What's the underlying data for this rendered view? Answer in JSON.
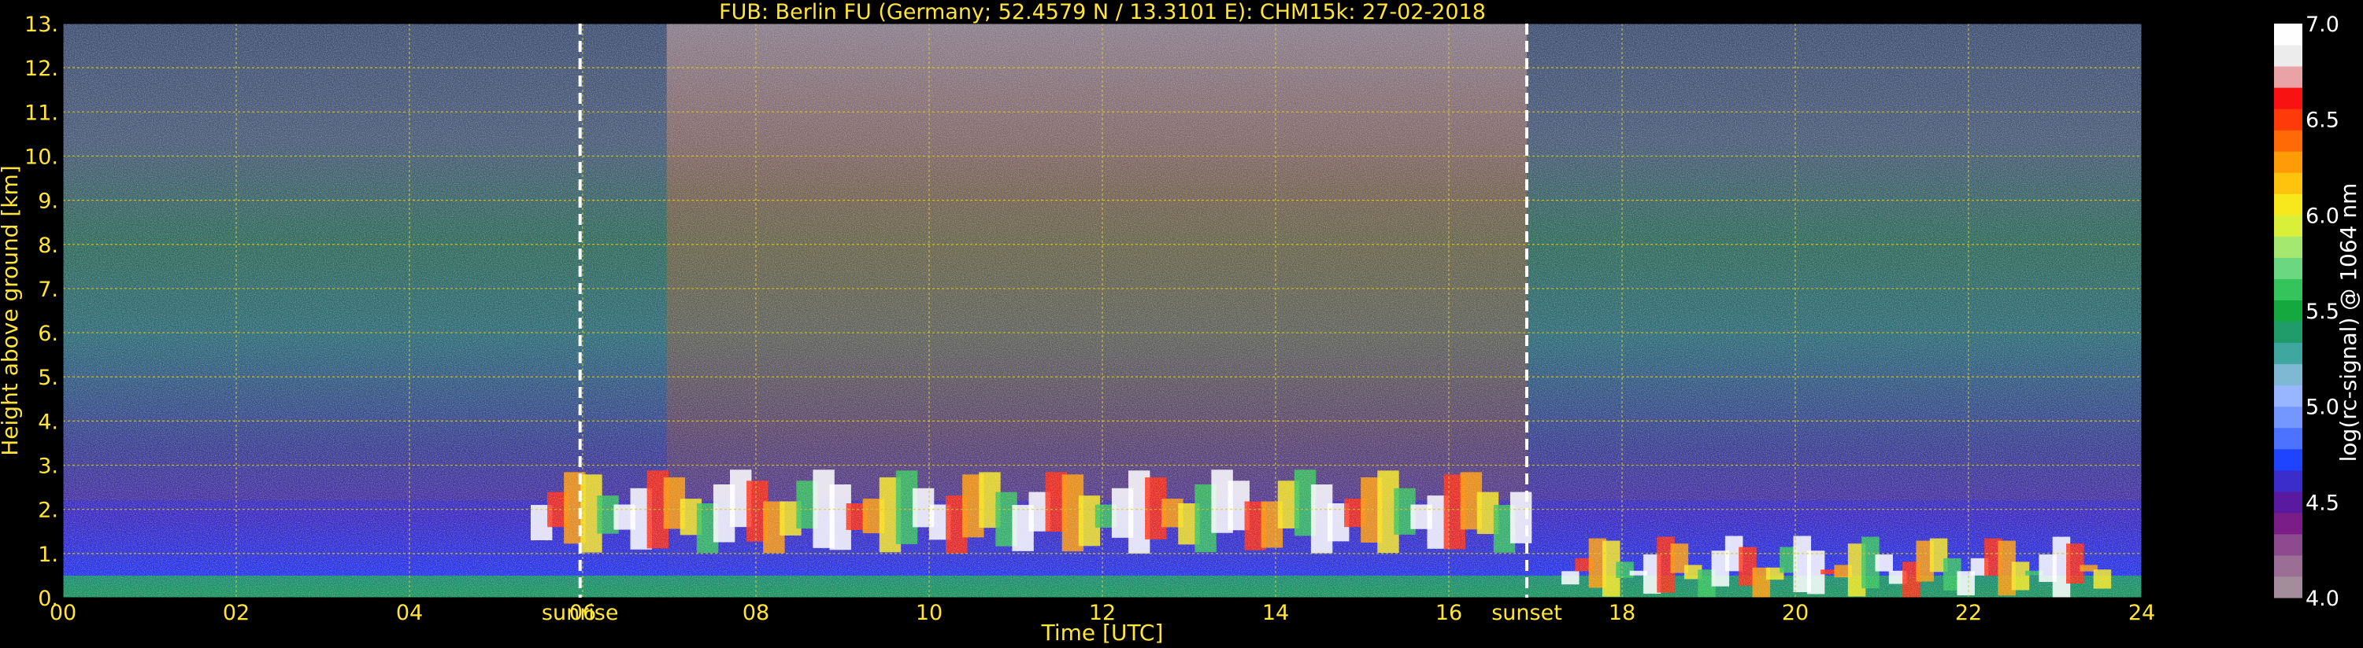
{
  "chart_data": {
    "type": "heatmap",
    "title": "FUB: Berlin FU (Germany; 52.4579 N / 13.3101 E):    CHM15k: 27-02-2018",
    "xlabel": "Time [UTC]",
    "ylabel": "Height above ground [km]",
    "xlim": [
      0,
      24
    ],
    "ylim": [
      0,
      13
    ],
    "x_ticks": [
      "00",
      "02",
      "04",
      "06",
      "08",
      "10",
      "12",
      "14",
      "16",
      "18",
      "20",
      "22",
      "24"
    ],
    "y_ticks": [
      "0.",
      "1.",
      "2.",
      "3.",
      "4.",
      "5.",
      "6.",
      "7.",
      "8.",
      "9.",
      "10.",
      "11.",
      "12.",
      "13."
    ],
    "grid": true,
    "markers": [
      {
        "label": "sunrise",
        "x": 5.97
      },
      {
        "label": "sunset",
        "x": 16.9
      }
    ],
    "colorbar": {
      "label": "log(rc-signal) @ 1064 nm",
      "range": [
        4.0,
        7.0
      ],
      "ticks": [
        "4.0",
        "4.5",
        "5.0",
        "5.5",
        "6.0",
        "6.5",
        "7.0"
      ],
      "colors": [
        "#a38d9b",
        "#9b6f95",
        "#8d4a8e",
        "#7a1d86",
        "#5a1aa0",
        "#3b2ccc",
        "#1f44ff",
        "#4b73ff",
        "#7397ff",
        "#98b6ff",
        "#7fb8d3",
        "#3fa6a0",
        "#1f9c6a",
        "#14a83f",
        "#35c35c",
        "#6bd780",
        "#a5e870",
        "#d8f03a",
        "#f7e81d",
        "#ffc20d",
        "#ff9b06",
        "#ff6a06",
        "#ff3a0a",
        "#f81212",
        "#e9a2a6",
        "#ececec",
        "#fefefe"
      ]
    },
    "features": [
      {
        "name": "boundary-layer",
        "x_range": [
          0,
          24
        ],
        "top_km": [
          0.5,
          2.2
        ]
      },
      {
        "name": "clouds",
        "x_range": [
          5.4,
          16.9
        ],
        "height_km": [
          1.0,
          2.9
        ]
      },
      {
        "name": "night-clouds",
        "x_range": [
          17.3,
          23.6
        ],
        "height_km": [
          0.0,
          1.4
        ]
      }
    ]
  },
  "colors": {
    "background": "#000000",
    "text": "#ffe53a",
    "grid": "#d6c93a",
    "marker": "#ffffff"
  }
}
